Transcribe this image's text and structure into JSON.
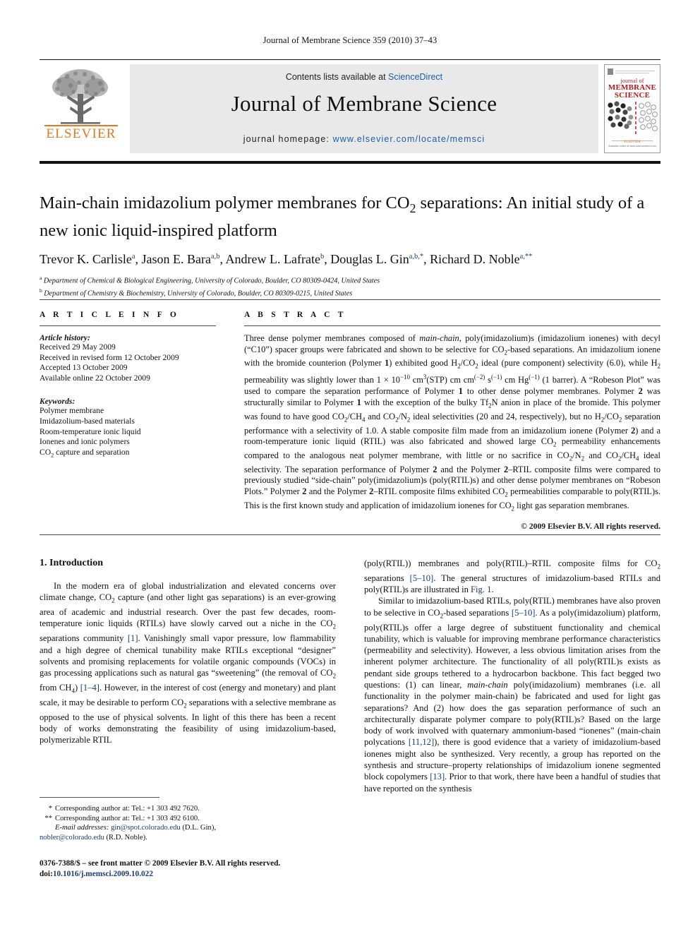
{
  "running_head": "Journal of Membrane Science 359 (2010) 37–43",
  "masthead": {
    "publisher_name": "ELSEVIER",
    "contents_prefix": "Contents lists available at ",
    "contents_link": "ScienceDirect",
    "journal_title": "Journal of Membrane Science",
    "homepage_label": "journal homepage: ",
    "homepage_url": "www.elsevier.com/locate/memsci",
    "cover": {
      "line1": "journal of",
      "line2": "MEMBRANE",
      "line3": "SCIENCE",
      "publisher": "ELSEVIER",
      "footer_note": "Available online at www.sciencedirect.com"
    }
  },
  "article": {
    "title": "Main-chain imidazolium polymer membranes for CO2 separations: An initial study of a new ionic liquid-inspired platform",
    "title_part1": "Main-chain imidazolium polymer membranes for CO",
    "title_sub": "2",
    "title_part2": " separations: An initial study of a new ionic liquid-inspired platform",
    "authors": [
      {
        "name": "Trevor K. Carlisle",
        "marks": "a"
      },
      {
        "name": "Jason E. Bara",
        "marks": "a,b"
      },
      {
        "name": "Andrew L. Lafrate",
        "marks": "b"
      },
      {
        "name": "Douglas L. Gin",
        "marks": "a,b,*"
      },
      {
        "name": "Richard D. Noble",
        "marks": "a,**"
      }
    ],
    "affiliations": [
      {
        "mark": "a",
        "text": "Department of Chemical & Biological Engineering, University of Colorado, Boulder, CO 80309-0424, United States"
      },
      {
        "mark": "b",
        "text": "Department of Chemistry & Biochemistry, University of Colorado, Boulder, CO 80309-0215, United States"
      }
    ]
  },
  "article_info": {
    "heading": "A R T I C L E    I N F O",
    "history_label": "Article history:",
    "history": [
      "Received 29 May 2009",
      "Received in revised form 12 October 2009",
      "Accepted 13 October 2009",
      "Available online 22 October 2009"
    ],
    "keywords_label": "Keywords:",
    "keywords": [
      "Polymer membrane",
      "Imidazolium-based materials",
      "Room-temperature ionic liquid",
      "Ionenes and ionic polymers",
      "CO2 capture and separation"
    ]
  },
  "abstract": {
    "heading": "A B S T R A C T",
    "text": "Three dense polymer membranes composed of main-chain, poly(imidazolium)s (imidazolium ionenes) with decyl (\"C10\") spacer groups were fabricated and shown to be selective for CO2-based separations. An imidazolium ionene with the bromide counterion (Polymer 1) exhibited good H2/CO2 ideal (pure component) selectivity (6.0), while H2 permeability was slightly lower than 1 × 10−10 cm3(STP) cm cm(−2) s(−1) cm Hg(−1) (1 barrer). A \"Robeson Plot\" was used to compare the separation performance of Polymer 1 to other dense polymer membranes. Polymer 2 was structurally similar to Polymer 1 with the exception of the bulky Tf2N anion in place of the bromide. This polymer was found to have good CO2/CH4 and CO2/N2 ideal selectivities (20 and 24, respectively), but no H2/CO2 separation performance with a selectivity of 1.0. A stable composite film made from an imidazolium ionene (Polymer 2) and a room-temperature ionic liquid (RTIL) was also fabricated and showed large CO2 permeability enhancements compared to the analogous neat polymer membrane, with little or no sacrifice in CO2/N2 and CO2/CH4 ideal selectivity. The separation performance of Polymer 2 and the Polymer 2–RTIL composite films were compared to previously studied \"side-chain\" poly(imidazolium)s (poly(RTIL)s) and other dense polymer membranes on \"Robeson Plots.\" Polymer 2 and the Polymer 2–RTIL composite films exhibited CO2 permeabilities comparable to poly(RTIL)s. This is the first known study and application of imidazolium ionenes for CO2 light gas separation membranes.",
    "copyright": "© 2009 Elsevier B.V. All rights reserved."
  },
  "sections": {
    "intro_heading": "1.  Introduction",
    "intro_p1": "In the modern era of global industrialization and elevated concerns over climate change, CO2 capture (and other light gas separations) is an ever-growing area of academic and industrial research. Over the past few decades, room-temperature ionic liquids (RTILs) have slowly carved out a niche in the CO2 separations community [1]. Vanishingly small vapor pressure, low flammability and a high degree of chemical tunability make RTILs exceptional \"designer\" solvents and promising replacements for volatile organic compounds (VOCs) in gas processing applications such as natural gas \"sweetening\" (the removal of CO2 from CH4) [1–4]. However, in the interest of cost (energy and monetary) and plant scale, it may be desirable to perform CO2 separations with a selective membrane as opposed to the use of physical solvents. In light of this there has been a recent body of works demonstrating the feasibility of using imidazolium-based, polymerizable RTIL (poly(RTIL)) membranes and poly(RTIL)–RTIL composite films for CO2 separations [5–10]. The general structures of imidazolium-based RTILs and poly(RTIL)s are illustrated in Fig. 1.",
    "intro_p2": "Similar to imidazolium-based RTILs, poly(RTIL) membranes have also proven to be selective in CO2-based separations [5–10]. As a poly(imidazolium) platform, poly(RTIL)s offer a large degree of substituent functionality and chemical tunability, which is valuable for improving membrane performance characteristics (permeability and selectivity). However, a less obvious limitation arises from the inherent polymer architecture. The functionality of all poly(RTIL)s exists as pendant side groups tethered to a hydrocarbon backbone. This fact begged two questions: (1) can linear, main-chain poly(imidazolium) membranes (i.e. all functionality in the polymer main-chain) be fabricated and used for light gas separations? And (2) how does the gas separation performance of such an architecturally disparate polymer compare to poly(RTIL)s? Based on the large body of work involved with quaternary ammonium-based \"ionenes\" (main-chain polycations [11,12]), there is good evidence that a variety of imidazolium-based ionenes might also be synthesized. Very recently, a group has reported on the synthesis and structure–property relationships of imidazolium ionene segmented block copolymers [13]. Prior to that work, there have been a handful of studies that have reported on the synthesis"
  },
  "footnotes": {
    "note1_mark": "*",
    "note1": "Corresponding author at: Tel.: +1 303 492 7620.",
    "note2_mark": "**",
    "note2": "Corresponding author at: Tel.: +1 303 492 6100.",
    "email_label": "E-mail addresses:",
    "email1": "gin@spot.colorado.edu",
    "email1_owner": "(D.L. Gin),",
    "email2": "nobler@colorado.edu",
    "email2_owner": "(R.D. Noble)."
  },
  "footer": {
    "issn_line": "0376-7388/$ – see front matter © 2009 Elsevier B.V. All rights reserved.",
    "doi_label": "doi:",
    "doi": "10.1016/j.memsci.2009.10.022"
  },
  "colors": {
    "link": "#1b3a7a",
    "elsevier_orange": "#E87722",
    "sciencedirect_blue": "#1b5fa8",
    "cover_red": "#b31b1b"
  }
}
